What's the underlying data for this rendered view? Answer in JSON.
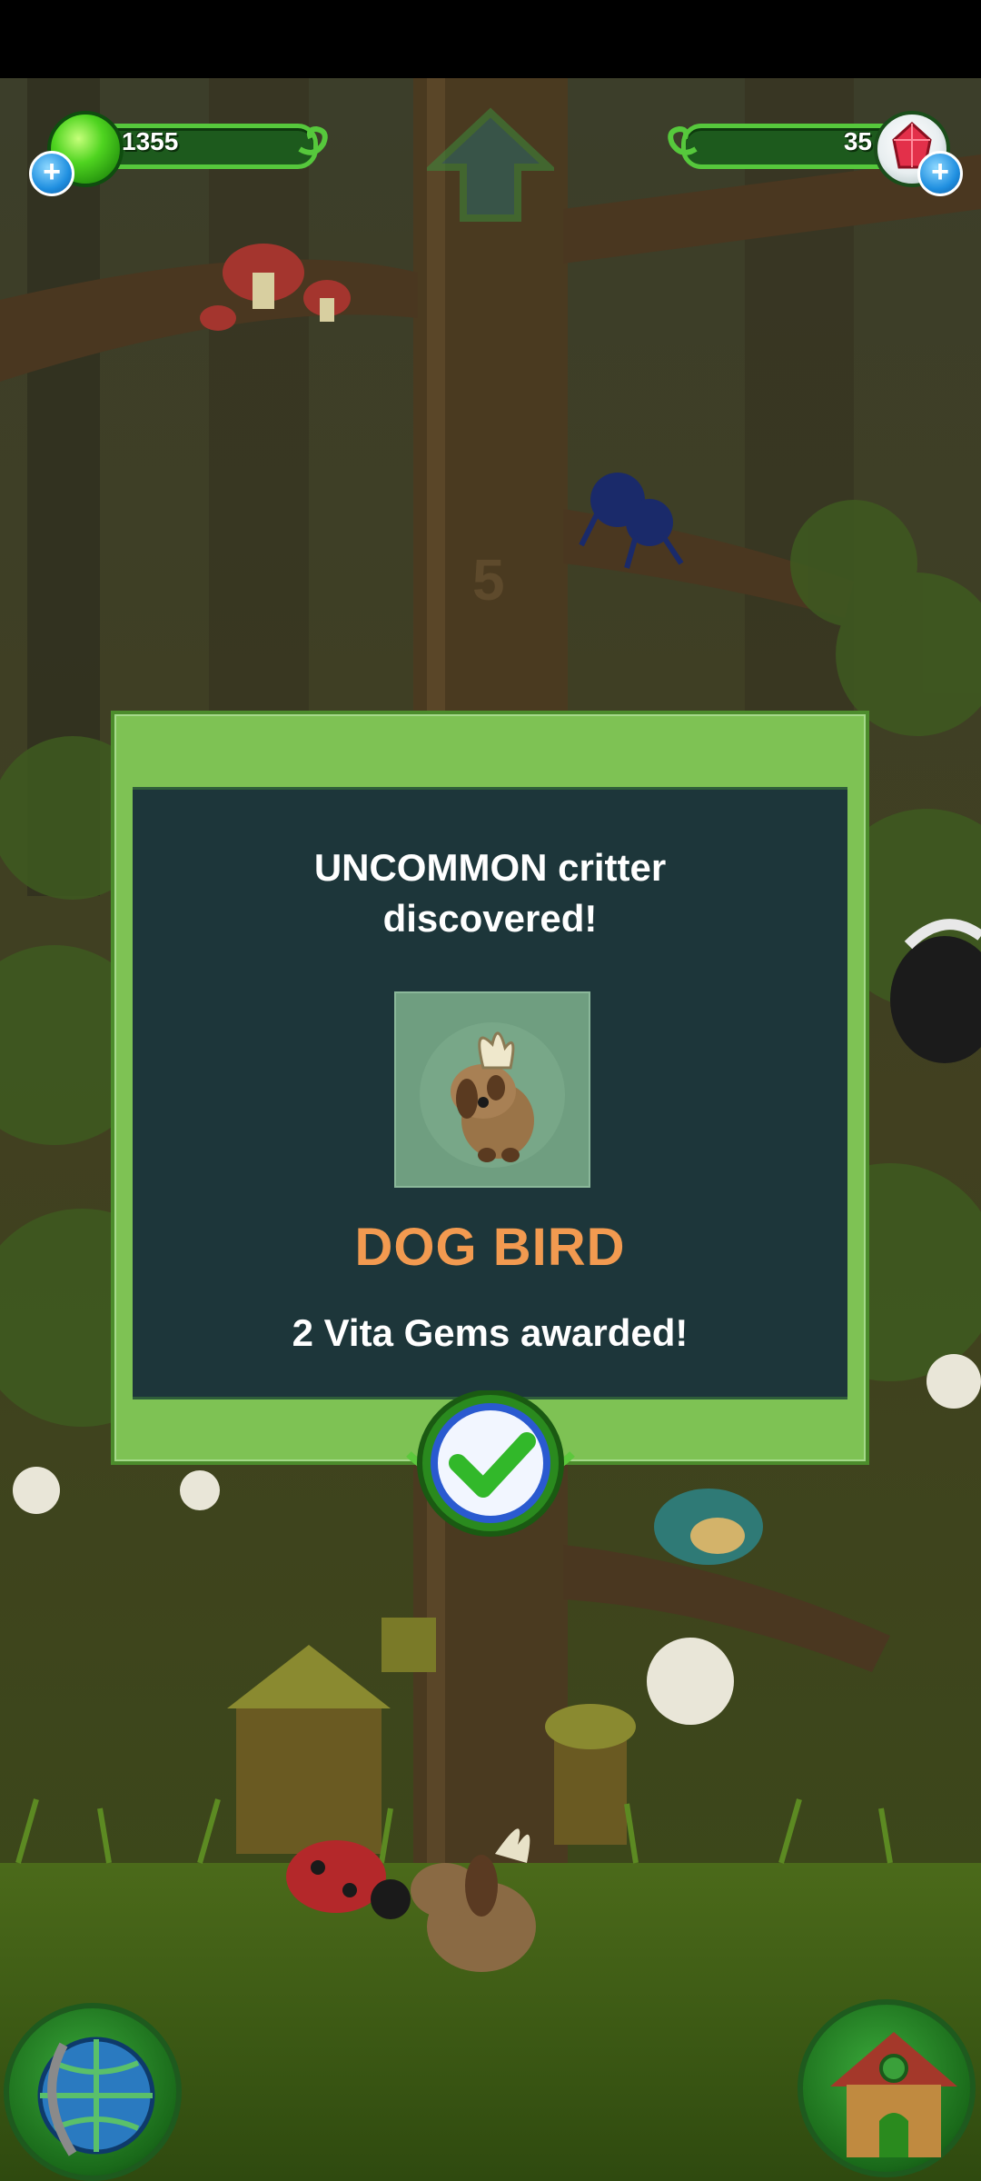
{
  "hud": {
    "goo_amount": "1355",
    "gem_amount": "35",
    "add_goo_label": "+",
    "add_gems_label": "+"
  },
  "scene": {
    "tree_level_marker": "5"
  },
  "popup": {
    "message_line1": "UNCOMMON critter",
    "message_line2": "discovered!",
    "critter_name": "DOG BIRD",
    "award_text": "2 Vita Gems awarded!"
  },
  "icons": {
    "goo": "goo-orb-icon",
    "gem": "vita-gem-icon",
    "confirm": "checkmark-icon",
    "world": "globe-icon",
    "house": "critter-house-icon",
    "up": "up-arrow-icon"
  },
  "colors": {
    "popup_frame": "#7ec254",
    "popup_panel": "#1d363a",
    "critter_name": "#f29a50",
    "hud_track": "#1d5a1d"
  }
}
